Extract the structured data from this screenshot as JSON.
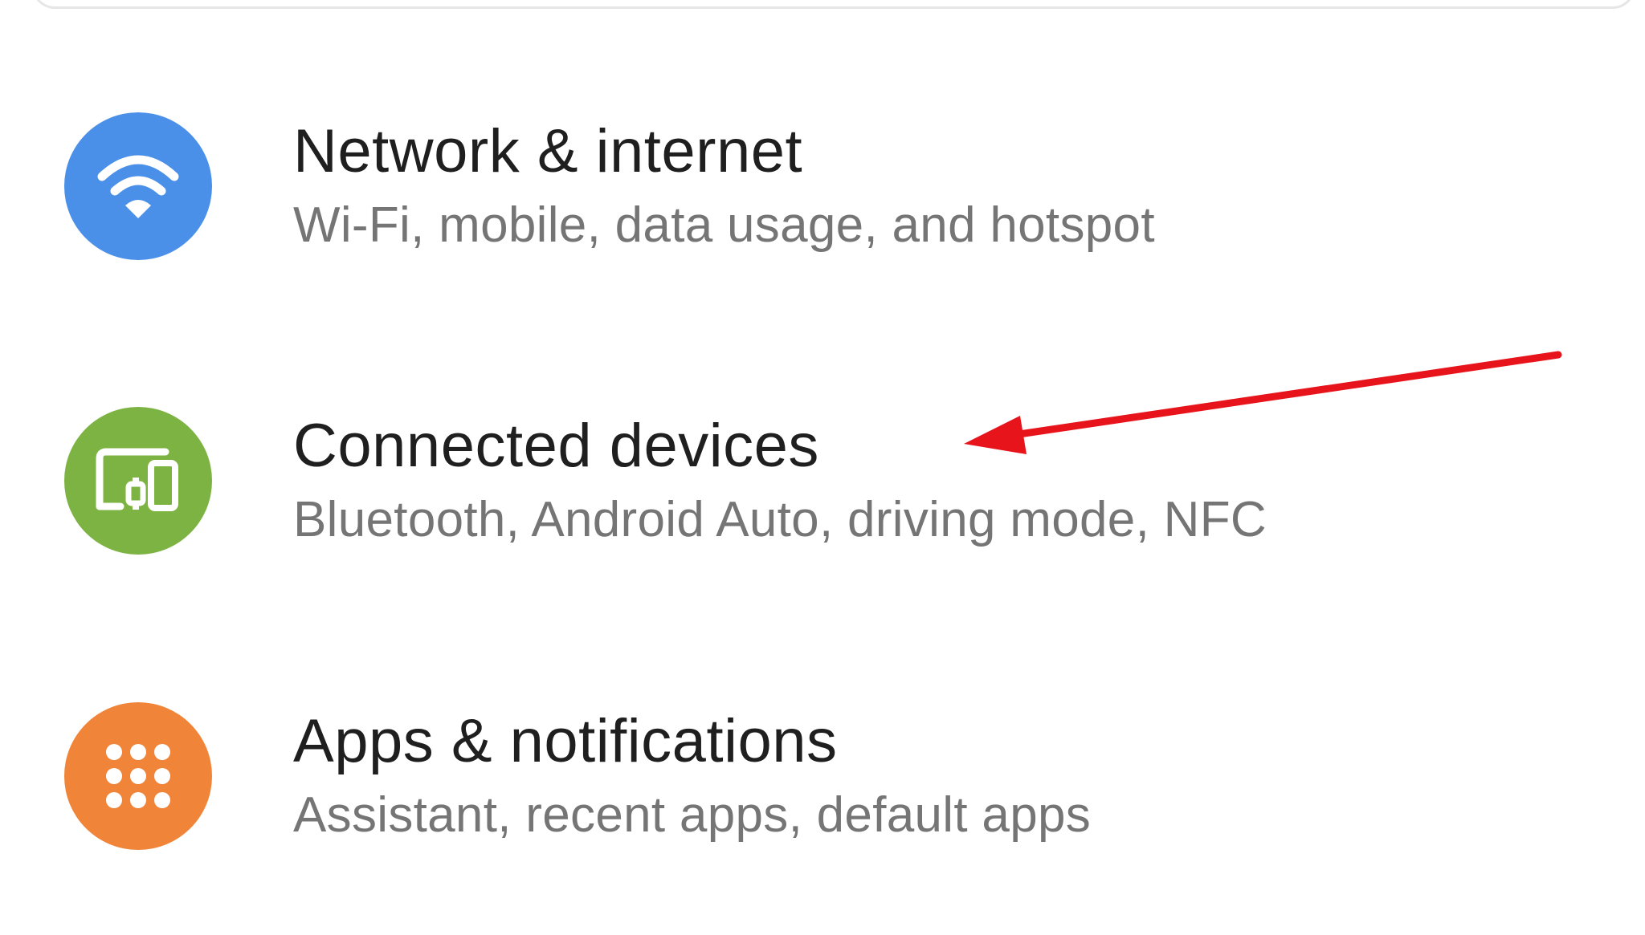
{
  "settings_list": {
    "items": [
      {
        "title": "Network & internet",
        "summary": "Wi-Fi, mobile, data usage, and hotspot",
        "icon": "wifi-icon",
        "color": "#4a90e8"
      },
      {
        "title": "Connected devices",
        "summary": "Bluetooth, Android Auto, driving mode, NFC",
        "icon": "devices-icon",
        "color": "#7cb342"
      },
      {
        "title": "Apps & notifications",
        "summary": "Assistant, recent apps, default apps",
        "icon": "apps-grid-icon",
        "color": "#f08438"
      }
    ]
  },
  "annotation": {
    "type": "arrow",
    "color": "#e8141c",
    "points_to": "Connected devices"
  }
}
